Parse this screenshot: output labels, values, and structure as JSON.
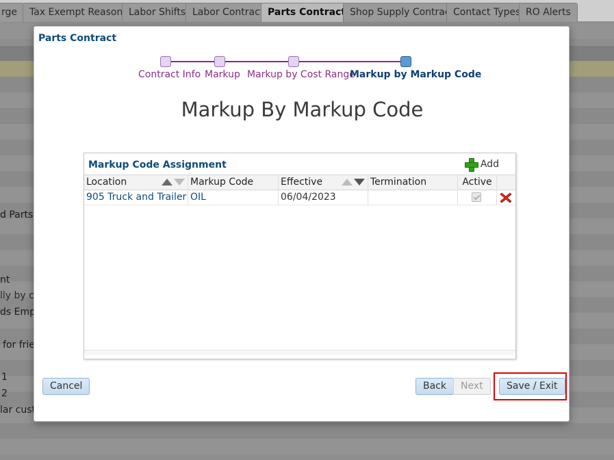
{
  "tabs": [
    {
      "label": "rge"
    },
    {
      "label": "Tax Exempt Reasons"
    },
    {
      "label": "Labor Shifts"
    },
    {
      "label": "Labor Contract"
    },
    {
      "label": "Parts Contract"
    },
    {
      "label": "Shop Supply Contract"
    },
    {
      "label": "Contact Types"
    },
    {
      "label": "RO Alerts"
    }
  ],
  "background_fragments": [
    "d Parts",
    "nt",
    "lly by co",
    "ds Emplo",
    "for frie",
    "1",
    "2",
    "lar custo"
  ],
  "modal": {
    "title": "Parts Contract",
    "wizard_steps": [
      {
        "label": "Contract Info"
      },
      {
        "label": "Markup"
      },
      {
        "label": "Markup by Cost Range"
      },
      {
        "label": "Markup by Markup Code"
      }
    ],
    "heading": "Markup By Markup Code",
    "panel": {
      "title": "Markup Code Assignment",
      "add_label": "Add",
      "columns": [
        "Location",
        "Markup Code",
        "Effective",
        "Termination",
        "Active"
      ],
      "rows": [
        {
          "location": "905 Truck and Trailer ...",
          "markup_code": "OIL",
          "effective": "06/04/2023",
          "termination": "",
          "active": true
        }
      ]
    },
    "buttons": {
      "cancel": "Cancel",
      "back": "Back",
      "next": "Next",
      "save_exit": "Save / Exit"
    }
  },
  "colors": {
    "accent": "#0f4b7a",
    "wizard": "#8a2f88",
    "highlight": "#e00000"
  }
}
